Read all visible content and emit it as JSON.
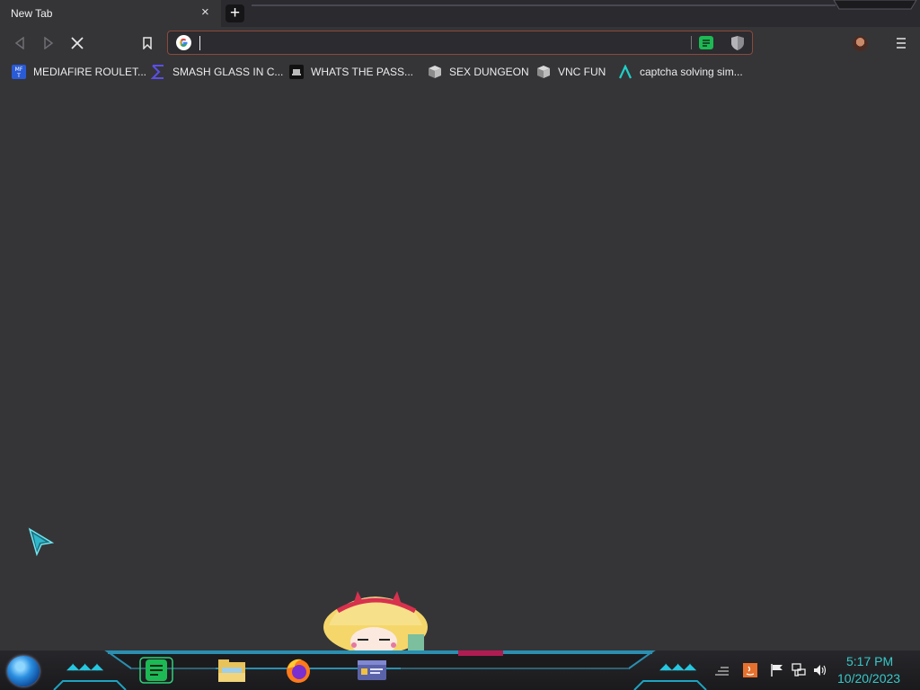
{
  "browser": {
    "tab": {
      "title": "New Tab",
      "close_glyph": "×"
    },
    "new_tab_glyph": "+",
    "toolbar": {
      "back_icon": "back-arrow-icon",
      "forward_icon": "forward-arrow-icon",
      "stop_icon": "stop-icon",
      "bookmark_icon": "bookmark-icon",
      "menu_icon": "hamburger-menu-icon"
    },
    "omnibox": {
      "value": "",
      "placeholder": "",
      "search_engine_icon": "google-icon"
    },
    "extensions": [
      "spotify-extension-icon",
      "shield-extension-icon"
    ],
    "profile_icon": "profile-avatar-icon"
  },
  "bookmarks": [
    {
      "label": "MEDIAFIRE ROULET...",
      "icon": "mediafire-icon"
    },
    {
      "label": "SMASH GLASS IN C...",
      "icon": "sigma-icon"
    },
    {
      "label": "WHATS THE PASS...",
      "icon": "terminal-icon"
    },
    {
      "label": "SEX DUNGEON",
      "icon": "cube-icon"
    },
    {
      "label": "VNC FUN",
      "icon": "cube-icon"
    },
    {
      "label": "captcha solving sim...",
      "icon": "lambda-icon"
    }
  ],
  "taskbar": {
    "start_icon": "start-orb-icon",
    "apps": [
      "notes-app-icon",
      "file-explorer-icon",
      "firefox-icon",
      "id-card-app-icon"
    ],
    "tray_icons": [
      "java-icon",
      "action-center-flag-icon",
      "network-icon",
      "volume-icon"
    ],
    "time": "5:17 PM",
    "date": "10/20/2023"
  },
  "colors": {
    "background": "#353538",
    "tabstrip": "#2b2a2f",
    "omnibox_border": "#8a4a3a",
    "clock": "#38c9c9",
    "accent_cyan": "#27c7e0"
  }
}
